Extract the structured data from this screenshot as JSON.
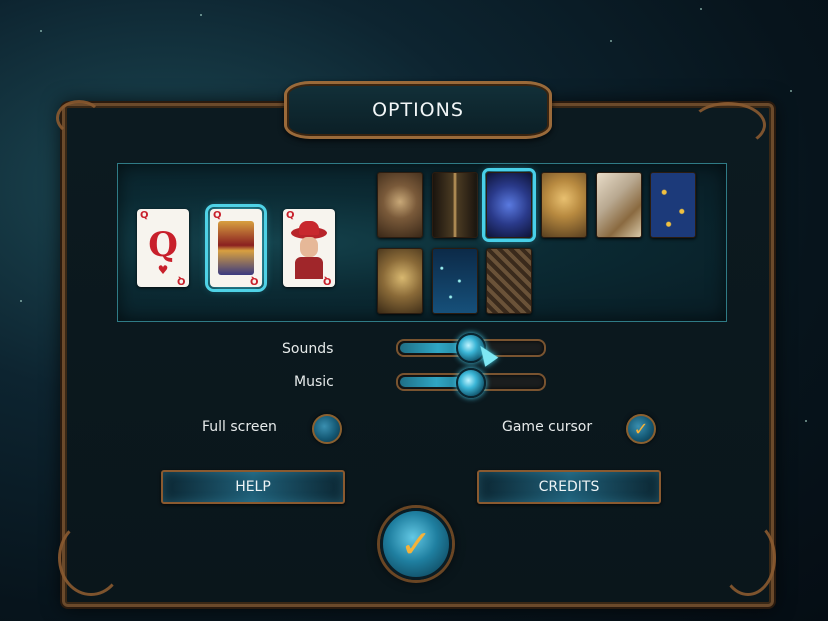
{
  "title": "OPTIONS",
  "card_faces": [
    {
      "name": "classic-queen-card",
      "rank": "Q",
      "suit": "♥",
      "selected": false
    },
    {
      "name": "ornate-queen-card",
      "rank": "Q",
      "suit": "♥",
      "selected": true
    },
    {
      "name": "illustrated-queen-card",
      "rank": "Q",
      "suit": "♥",
      "selected": false
    }
  ],
  "card_backs": [
    {
      "name": "pocket-watch-back",
      "color": "#7a5a3a",
      "selected": false
    },
    {
      "name": "dark-corridor-back",
      "color": "#2a2218",
      "selected": false
    },
    {
      "name": "night-creature-back",
      "color": "#2a3a8a",
      "selected": true
    },
    {
      "name": "golden-coin-back",
      "color": "#8a6a30",
      "selected": false
    },
    {
      "name": "feather-back",
      "color": "#b8a890",
      "selected": false
    },
    {
      "name": "starry-blue-back",
      "color": "#1c3a7a",
      "selected": false
    },
    {
      "name": "compass-back",
      "color": "#6a5430",
      "selected": false
    },
    {
      "name": "night-sky-back",
      "color": "#0f3a5c",
      "selected": false
    },
    {
      "name": "tangled-roots-back",
      "color": "#5a4430",
      "selected": false
    }
  ],
  "sounds": {
    "label": "Sounds",
    "level": 0.52
  },
  "music": {
    "label": "Music",
    "level": 0.5
  },
  "full_screen": {
    "label": "Full screen",
    "checked": false
  },
  "game_cursor": {
    "label": "Game cursor",
    "checked": true
  },
  "buttons": {
    "help": "HELP",
    "credits": "CREDITS"
  },
  "icons": {
    "confirm": "checkmark-icon"
  }
}
